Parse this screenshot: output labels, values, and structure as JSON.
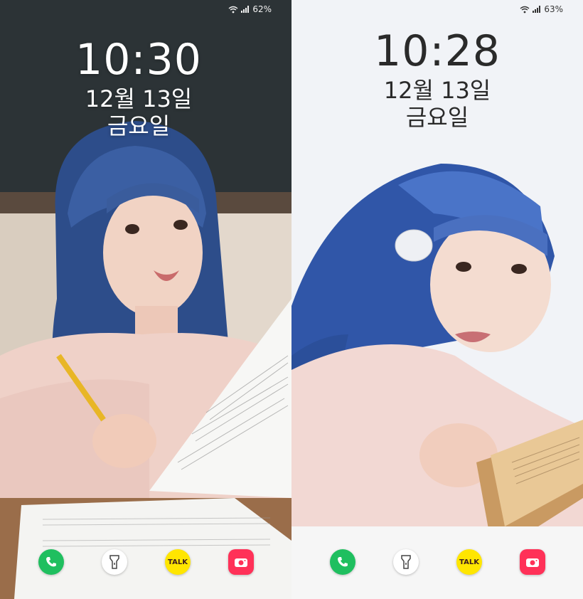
{
  "screens": [
    {
      "status": {
        "battery": "62%"
      },
      "clock": {
        "time": "10:30",
        "date": "12월 13일",
        "day": "금요일"
      },
      "dock": [
        {
          "icon": "phone-icon"
        },
        {
          "icon": "flashlight-icon"
        },
        {
          "icon": "kakaotalk-icon",
          "label": "TALK"
        },
        {
          "icon": "camera-icon"
        }
      ]
    },
    {
      "status": {
        "battery": "63%"
      },
      "clock": {
        "time": "10:28",
        "date": "12월 13일",
        "day": "금요일"
      },
      "dock": [
        {
          "icon": "phone-icon"
        },
        {
          "icon": "flashlight-icon"
        },
        {
          "icon": "kakaotalk-icon",
          "label": "TALK"
        },
        {
          "icon": "camera-icon"
        }
      ]
    }
  ],
  "colors": {
    "phone": "#1fbf5f",
    "kakaotalk": "#ffe600",
    "camera": "#ff3158"
  }
}
